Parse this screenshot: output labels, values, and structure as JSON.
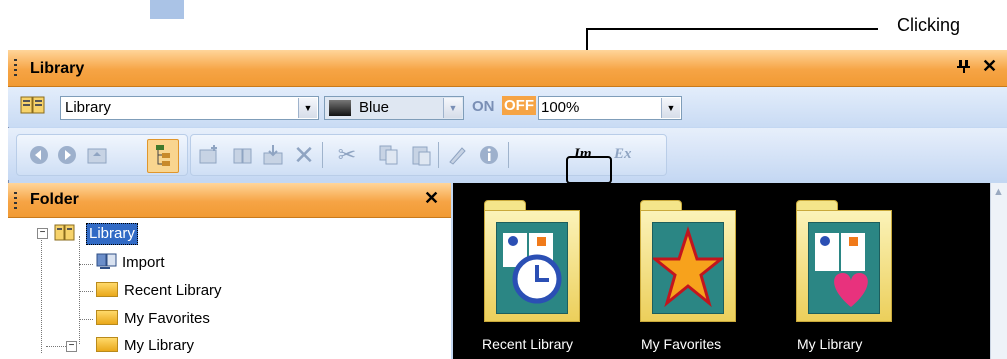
{
  "callout": {
    "label": "Clicking"
  },
  "window": {
    "title": "Library",
    "pin_glyph": "ᚚ",
    "close_glyph": "✕"
  },
  "toolbar1": {
    "library_select": "Library",
    "color_select": "Blue",
    "on_label": "ON",
    "off_label": "OFF",
    "zoom_select": "100%"
  },
  "toolbar2": {
    "icons": [
      "back-icon",
      "forward-icon",
      "up-folder-icon",
      "tree-view-icon",
      "new-folder-icon",
      "new-library-icon",
      "import-icon",
      "delete-icon",
      "cut-icon",
      "copy-icon",
      "paste-icon",
      "edit-icon",
      "info-icon",
      "import-member-icon",
      "export-icon"
    ],
    "import_member_label": "Im",
    "export_label": "Ex"
  },
  "folder_panel": {
    "title": "Folder",
    "close_glyph": "✕",
    "tree": [
      {
        "label": "Library",
        "selected": true
      },
      {
        "label": "Import"
      },
      {
        "label": "Recent Library"
      },
      {
        "label": "My Favorites"
      },
      {
        "label": "My Library"
      }
    ]
  },
  "content": {
    "items": [
      {
        "label": "Recent Library",
        "icon": "recent-library-folder-icon"
      },
      {
        "label": "My Favorites",
        "icon": "my-favorites-folder-icon"
      },
      {
        "label": "My Library",
        "icon": "my-library-folder-icon"
      }
    ]
  },
  "colors": {
    "title_bar": "#f6a445",
    "toolbar_bg": "#c9dbf4",
    "content_bg": "#000000",
    "selection": "#316ac5",
    "off_toggle": "#f6a445"
  }
}
